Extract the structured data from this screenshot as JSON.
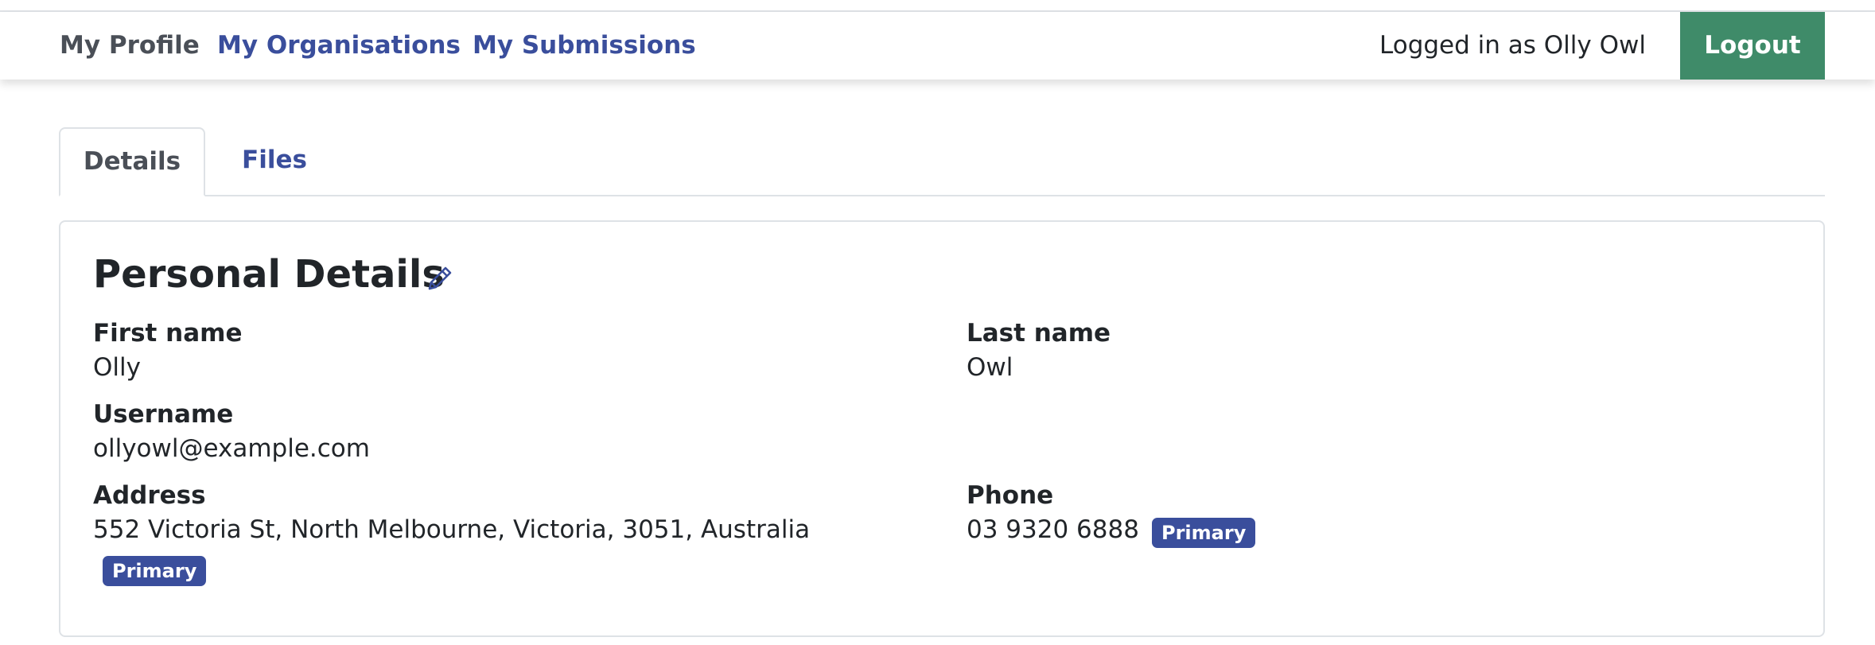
{
  "nav": {
    "links": [
      {
        "label": "My Profile",
        "active": true
      },
      {
        "label": "My Organisations",
        "active": false
      },
      {
        "label": "My Submissions",
        "active": false
      }
    ],
    "logged_in_text": "Logged in as Olly Owl",
    "logout_label": "Logout"
  },
  "tabs": [
    {
      "label": "Details",
      "active": true
    },
    {
      "label": "Files",
      "active": false
    }
  ],
  "card": {
    "title": "Personal Details",
    "edit_icon": "pencil-icon",
    "fields": {
      "first_name": {
        "label": "First name",
        "value": "Olly"
      },
      "last_name": {
        "label": "Last name",
        "value": "Owl"
      },
      "username": {
        "label": "Username",
        "value": "ollyowl@example.com"
      },
      "address": {
        "label": "Address",
        "value": "552 Victoria St, North Melbourne, Victoria, 3051, Australia",
        "badge": "Primary"
      },
      "phone": {
        "label": "Phone",
        "value": "03 9320 6888",
        "badge": "Primary"
      }
    }
  },
  "colors": {
    "link": "#3a4e9c",
    "logout_bg": "#3f8b69",
    "badge_bg": "#3a4e9c"
  }
}
